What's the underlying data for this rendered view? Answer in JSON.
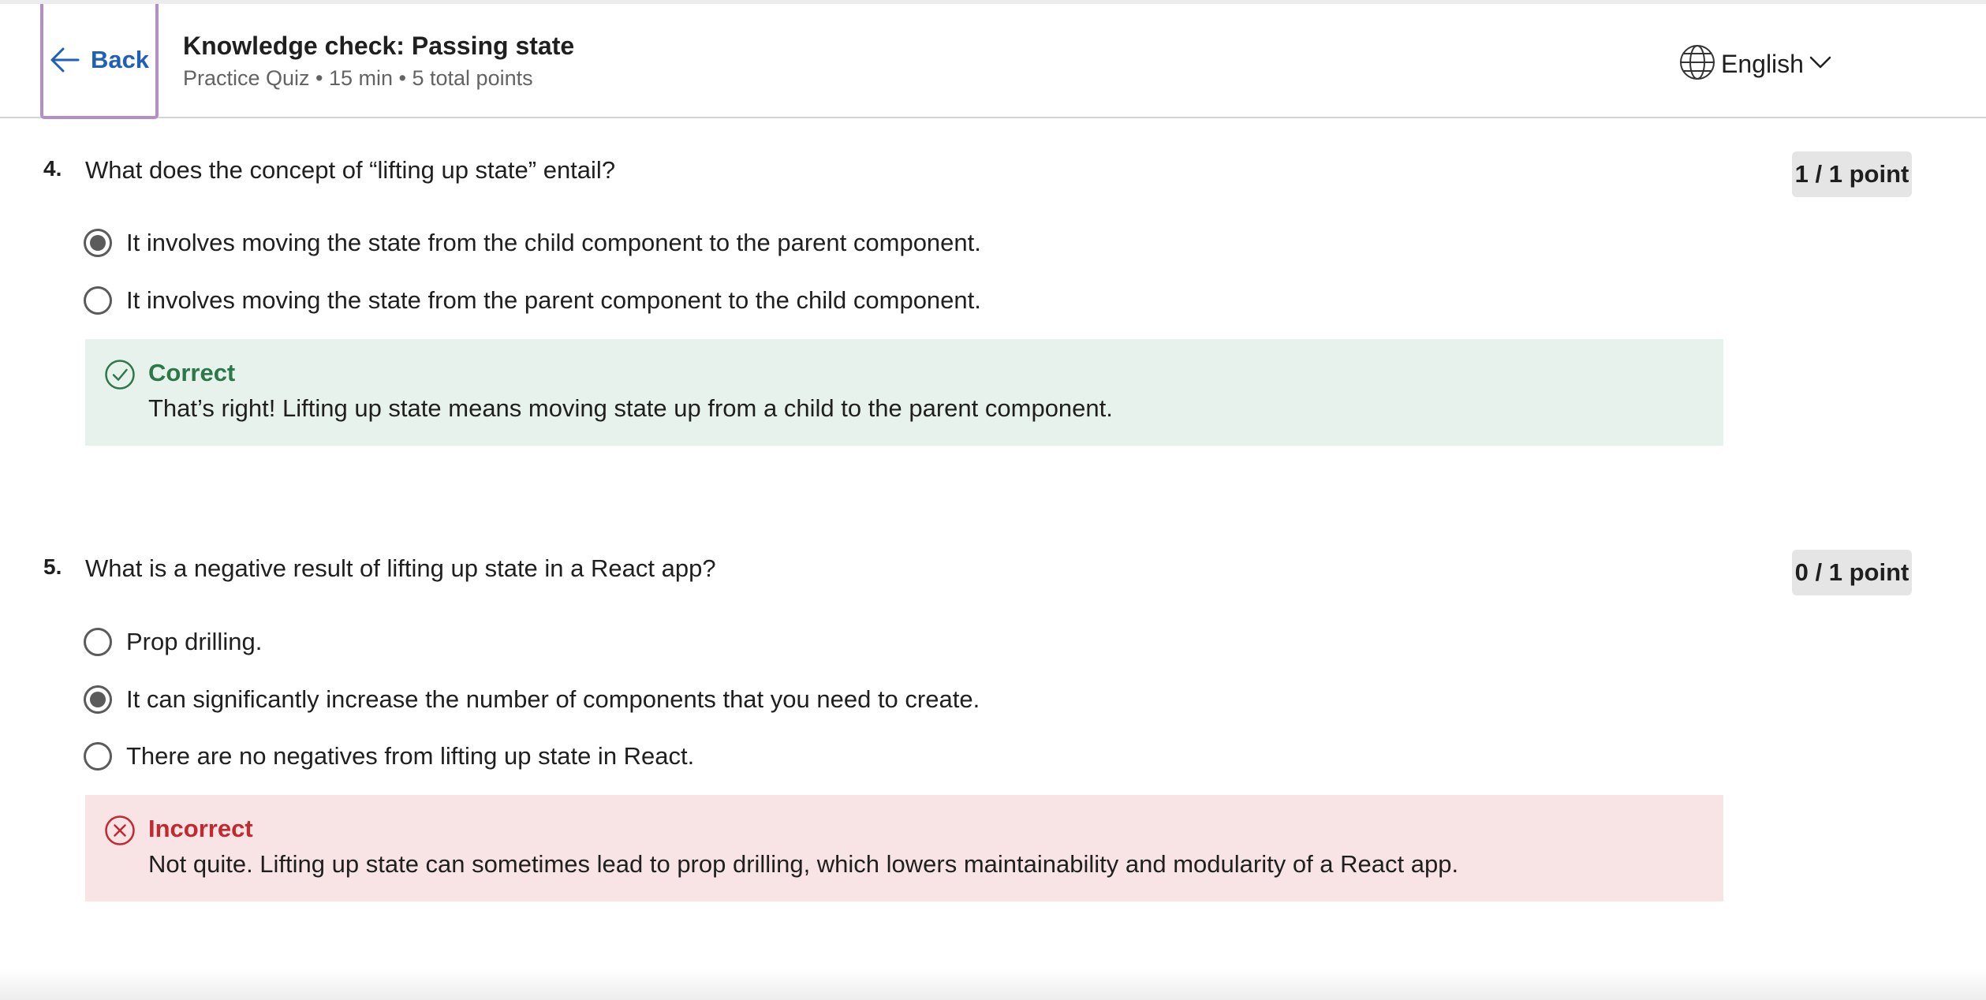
{
  "header": {
    "back_label": "Back",
    "title": "Knowledge check: Passing state",
    "meta": "Practice Quiz • 15 min • 5 total points",
    "language": "English"
  },
  "questions": [
    {
      "number": "4.",
      "text": "What does the concept of “lifting up state” entail?",
      "points": "1 / 1 point",
      "options": [
        {
          "label": "It involves moving the state from the child component to the parent component.",
          "selected": true
        },
        {
          "label": "It involves moving the state from the parent component to the child component.",
          "selected": false
        }
      ],
      "feedback": {
        "status": "correct",
        "title": "Correct",
        "text": "That’s right! Lifting up state means moving state up from a child to the parent component."
      }
    },
    {
      "number": "5.",
      "text": "What is a negative result of lifting up state in a React app?",
      "points": "0 / 1 point",
      "options": [
        {
          "label": "Prop drilling.",
          "selected": false
        },
        {
          "label": "It can significantly increase the number of components that you need to create.",
          "selected": true
        },
        {
          "label": "There are no negatives from lifting up state in React.",
          "selected": false
        }
      ],
      "feedback": {
        "status": "incorrect",
        "title": "Incorrect",
        "text": "Not quite. Lifting up state can sometimes lead to prop drilling, which lowers maintainability and modularity of a React app."
      }
    }
  ],
  "colors": {
    "link_blue": "#1f5fb8",
    "focus_outline": "#b48ec8",
    "correct_bg": "#e8f2ec",
    "correct_text": "#2c7848",
    "incorrect_bg": "#f8e4e5",
    "incorrect_text": "#c3282f"
  },
  "icons": {
    "back": "arrow-left-icon",
    "language": "globe-icon",
    "dropdown": "chevron-down-icon",
    "correct": "check-circle-icon",
    "incorrect": "x-circle-icon"
  }
}
